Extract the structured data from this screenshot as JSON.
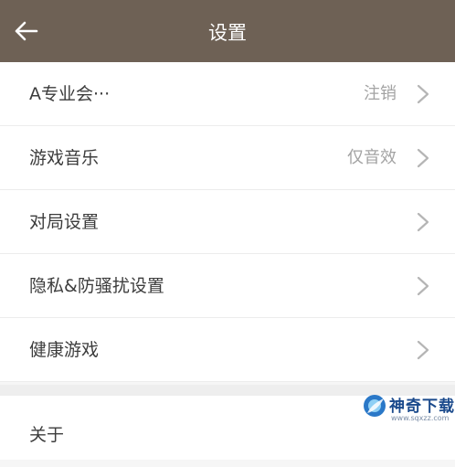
{
  "header": {
    "title": "设置"
  },
  "settings": {
    "items": [
      {
        "label": "A专业会···",
        "value": "注销"
      },
      {
        "label": "游戏音乐",
        "value": "仅音效"
      },
      {
        "label": "对局设置",
        "value": ""
      },
      {
        "label": "隐私&防骚扰设置",
        "value": ""
      },
      {
        "label": "健康游戏",
        "value": ""
      }
    ],
    "about_label": "关于"
  },
  "watermark": {
    "name": "神奇下载",
    "url": "www.sqxzz.com"
  },
  "colors": {
    "header_bg": "#6e6155",
    "text": "#3c3c3c",
    "value_text": "#a3a3a3",
    "chevron": "#b5b5b5"
  }
}
